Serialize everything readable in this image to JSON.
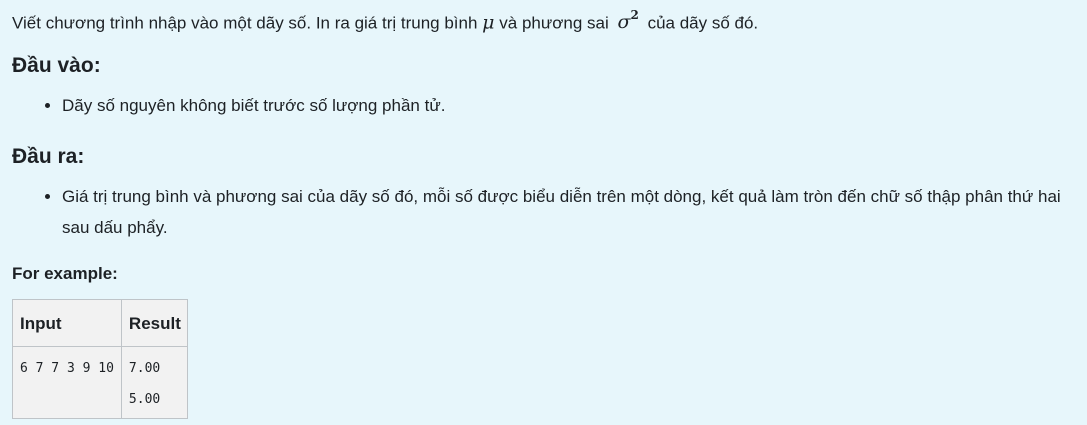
{
  "intro": {
    "text_before_mu": "Viết chương trình nhập vào một dãy số. In ra giá trị trung bình",
    "mu_symbol": "μ",
    "text_between": "và phương sai",
    "sigma_symbol": "σ",
    "sigma_exponent": "2",
    "text_after_sigma": "của dãy số đó."
  },
  "input_section": {
    "heading": "Đầu vào:",
    "items": [
      "Dãy số nguyên không biết trước số lượng phần tử."
    ]
  },
  "output_section": {
    "heading": "Đầu ra:",
    "items": [
      "Giá trị trung bình và phương sai của dãy số đó, mỗi số được biểu diễn trên một dòng, kết quả làm tròn đến chữ số thập phân thứ hai sau dấu phẩy."
    ]
  },
  "example": {
    "label": "For example:",
    "headers": [
      "Input",
      "Result"
    ],
    "rows": [
      {
        "input": "6 7 7 3 9 10",
        "result_lines": [
          "7.00",
          "5.00"
        ]
      }
    ]
  }
}
